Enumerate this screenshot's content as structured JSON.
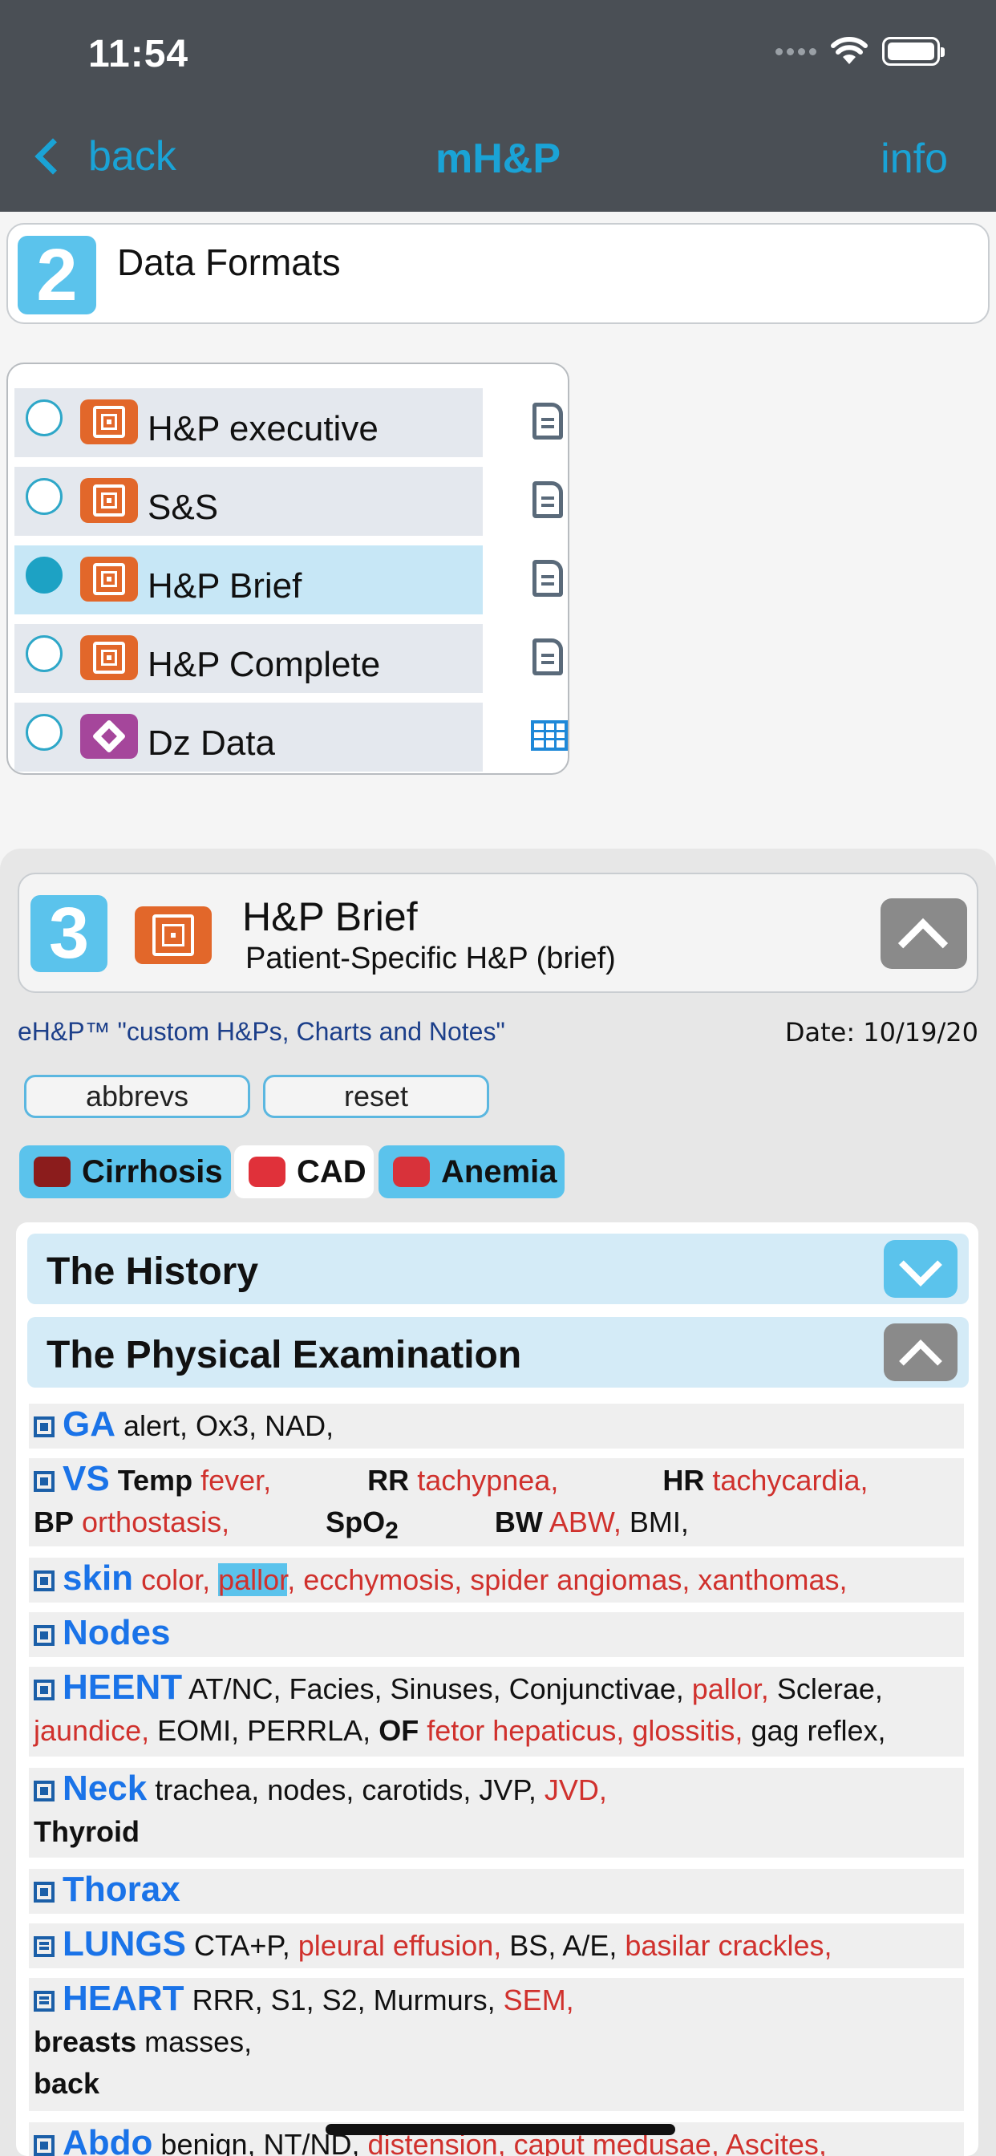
{
  "status_bar": {
    "time": "11:54"
  },
  "nav": {
    "back_label": "back",
    "title": "mH&P",
    "info_label": "info"
  },
  "section2": {
    "number": "2",
    "title": "Data Formats",
    "formats": [
      {
        "label": "H&P executive",
        "selected": false,
        "icon": "target-icon",
        "action_icon": "document-icon"
      },
      {
        "label": "S&S",
        "selected": false,
        "icon": "target-icon",
        "action_icon": "document-icon"
      },
      {
        "label": "H&P Brief",
        "selected": true,
        "icon": "target-icon",
        "action_icon": "document-icon"
      },
      {
        "label": "H&P Complete",
        "selected": false,
        "icon": "target-icon",
        "action_icon": "document-icon"
      },
      {
        "label": "Dz Data",
        "selected": false,
        "icon": "diamond-icon",
        "action_icon": "table-icon"
      }
    ]
  },
  "section3": {
    "number": "3",
    "title": "H&P Brief",
    "subtitle": "Patient-Specific H&P (brief)",
    "tagline": "eH&P™ \"custom H&Ps, Charts and Notes\"",
    "date": "Date: 10/19/20",
    "buttons": {
      "abbrevs": "abbrevs",
      "reset": "reset"
    },
    "disease_tabs": [
      {
        "label": "Cirrhosis",
        "color": "#5bc3ec"
      },
      {
        "label": "CAD",
        "color": "#ffffff"
      },
      {
        "label": "Anemia",
        "color": "#5bc3ec"
      }
    ],
    "history_title": "The History",
    "exam_title": "The Physical Examination",
    "exam": {
      "ga": {
        "label": "GA",
        "text": "alert, Ox3, NAD,"
      },
      "vs": {
        "label": "VS",
        "temp": "Temp",
        "temp_val": "fever,",
        "rr": "RR",
        "rr_val": "tachypnea,",
        "hr": "HR",
        "hr_val": "tachycardia,",
        "bp": "BP",
        "bp_val": "orthostasis,",
        "spo2": "SpO",
        "spo2_sub": "2",
        "bw": "BW",
        "bw_val": "ABW,",
        "bmi": "BMI,"
      },
      "skin": {
        "label": "skin",
        "t1": "color,",
        "t2": "pallor",
        "t3": ", ecchymosis, spider angiomas, xanthomas,"
      },
      "nodes": {
        "label": "Nodes"
      },
      "heent": {
        "label": "HEENT",
        "t1": "AT/NC, Facies, Sinuses, Conjunctivae,",
        "t2": "pallor,",
        "t3": "Sclerae,",
        "t4": "jaundice,",
        "t5": "EOMI, PERRLA,",
        "t6": "OF",
        "t7": "fetor hepaticus, glossitis,",
        "t8": "gag reflex,"
      },
      "neck": {
        "label": "Neck",
        "t1": "trachea, nodes, carotids, JVP,",
        "t2": "JVD,",
        "t3": "Thyroid"
      },
      "thorax": {
        "label": "Thorax"
      },
      "lungs": {
        "label": "LUNGS",
        "t1": "CTA+P,",
        "t2": "pleural effusion,",
        "t3": "BS, A/E,",
        "t4": "basilar crackles,"
      },
      "heart": {
        "label": "HEART",
        "t1": "RRR, S1, S2, Murmurs,",
        "t2": "SEM,",
        "t3": "breasts",
        "t4": "masses,",
        "t5": "back"
      },
      "abdo": {
        "label": "Abdo",
        "t1": "benign, NT/ND,",
        "t2": "distension, caput medusae, Ascites,"
      }
    }
  }
}
